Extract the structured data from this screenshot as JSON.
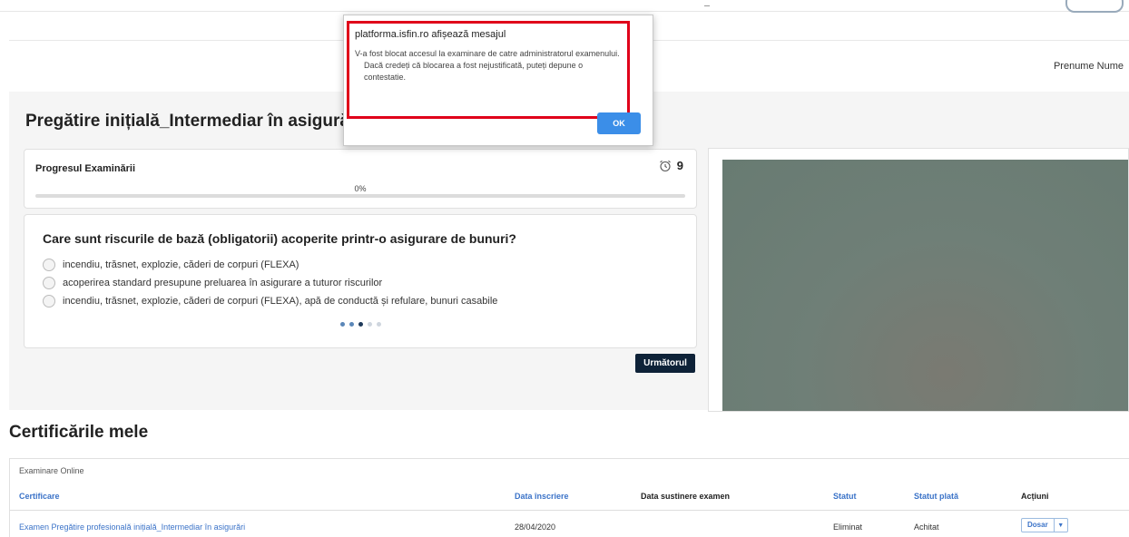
{
  "header": {
    "user_name": "Prenume Nume"
  },
  "exam": {
    "title": "Pregătire inițială_Intermediar în asigurări",
    "progress_label": "Progresul Examinării",
    "progress_text": "0%",
    "progress_value": 0,
    "timer_value": "9",
    "question": "Care sunt riscurile de bază (obligatorii) acoperite printr-o asigurare de bunuri?",
    "options": [
      "incendiu, trăsnet, explozie, căderi de corpuri (FLEXA)",
      "acoperirea standard presupune preluarea în asigurare a tuturor riscurilor",
      "incendiu, trăsnet, explozie, căderi de corpuri (FLEXA), apă de conductă și refulare, bunuri casabile"
    ],
    "pagination": {
      "total": 5,
      "current": 3
    },
    "next_label": "Următorul"
  },
  "certificates": {
    "title": "Certificările mele",
    "subtitle": "Examinare Online",
    "columns": [
      "Certificare",
      "Data înscriere",
      "Data sustinere examen",
      "Statut",
      "Statut plată",
      "Acțiuni"
    ],
    "rows": [
      {
        "certificare": "Examen Pregătire profesională inițială_Intermediar în asigurări",
        "data_inscriere": "28/04/2020",
        "data_sustinere": "",
        "statut": "Eliminat",
        "statut_plata": "Achitat",
        "action_label": "Dosar"
      }
    ]
  },
  "dialog": {
    "host": "platforma.isfin.ro afișează mesajul",
    "message_line1": "V-a fost blocat accesul la examinare de catre administratorul examenului.",
    "message_line2": "Dacă credeți că blocarea a fost nejustificată, puteți depune o contestatie.",
    "ok_label": "OK",
    "highlight_color": "#e0001a"
  },
  "colors": {
    "accent": "#3b73c8",
    "dark_button": "#0e2238",
    "ok_button": "#3b8ee8"
  }
}
